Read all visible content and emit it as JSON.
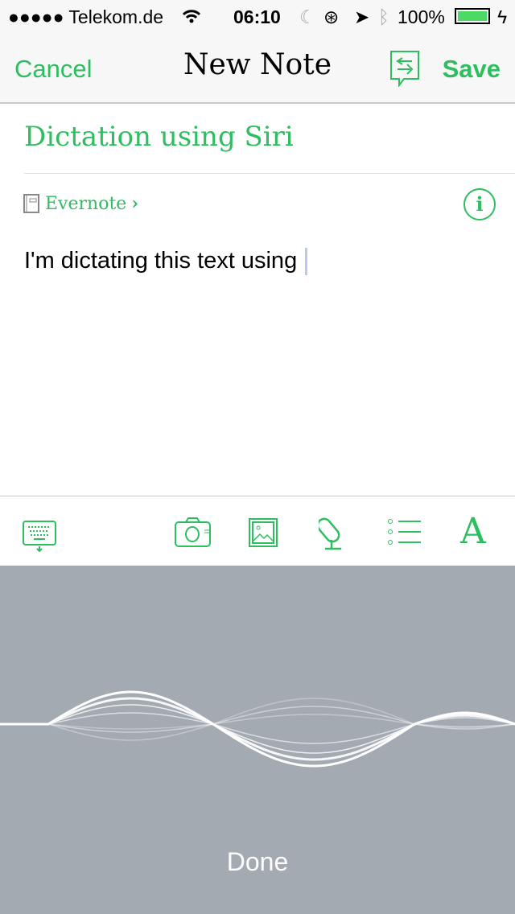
{
  "status_bar": {
    "carrier": "●●●●● Telekom.de",
    "time": "06:10",
    "battery": "100%",
    "icons": [
      "wifi-icon",
      "moon-icon",
      "rotation-lock-icon",
      "location-icon",
      "bluetooth-icon",
      "battery-icon",
      "charging-icon"
    ]
  },
  "nav": {
    "cancel": "Cancel",
    "title": "New Note",
    "save": "Save",
    "share_icon": "share-chat-icon"
  },
  "note": {
    "title": "Dictation using Siri",
    "notebook": "Evernote",
    "body": "I'm dictating this text using"
  },
  "toolbar": {
    "icons": [
      "keyboard-dismiss-icon",
      "camera-icon",
      "image-icon",
      "attachment-mic-icon",
      "list-icon",
      "text-format-icon"
    ]
  },
  "dictation": {
    "done": "Done"
  },
  "colors": {
    "accent": "#2dbe60",
    "dictation_bg": "#a4aab2"
  }
}
